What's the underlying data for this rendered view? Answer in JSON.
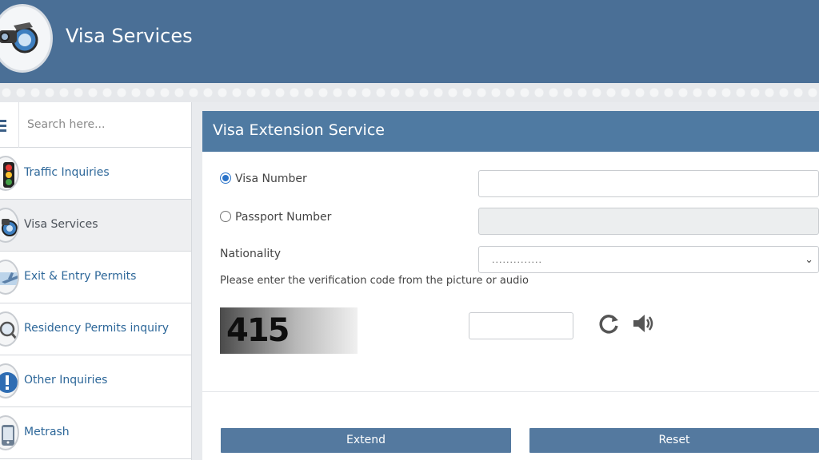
{
  "header": {
    "title": "Visa Services",
    "logo_icon": "visa-globe-logo"
  },
  "sidebar": {
    "search_placeholder": "Search here...",
    "items": [
      {
        "label": "Traffic Inquiries",
        "icon": "traffic-light-icon",
        "active": false
      },
      {
        "label": "Visa Services",
        "icon": "visa-globe-icon",
        "active": true
      },
      {
        "label": "Exit & Entry Permits",
        "icon": "airplane-icon",
        "active": false
      },
      {
        "label": "Residency Permits inquiry",
        "icon": "magnifier-icon",
        "active": false
      },
      {
        "label": "Other Inquiries",
        "icon": "exclamation-icon",
        "active": false
      },
      {
        "label": "Metrash",
        "icon": "metrash-icon",
        "active": false
      }
    ]
  },
  "panel": {
    "title": "Visa Extension Service",
    "visa_number_label": "Visa Number",
    "passport_number_label": "Passport Number",
    "nationality_label": "Nationality",
    "nationality_value": "..............",
    "verification_prompt": "Please enter the verification code from the picture or audio",
    "captcha_text": "415",
    "selected_option": "Visa Number"
  },
  "buttons": {
    "extend": "Extend",
    "reset": "Reset"
  },
  "colors": {
    "header_bg": "#4a6f96",
    "panel_header_bg": "#4f7aa2",
    "button_bg": "#54799f",
    "link_text": "#2d6799"
  }
}
